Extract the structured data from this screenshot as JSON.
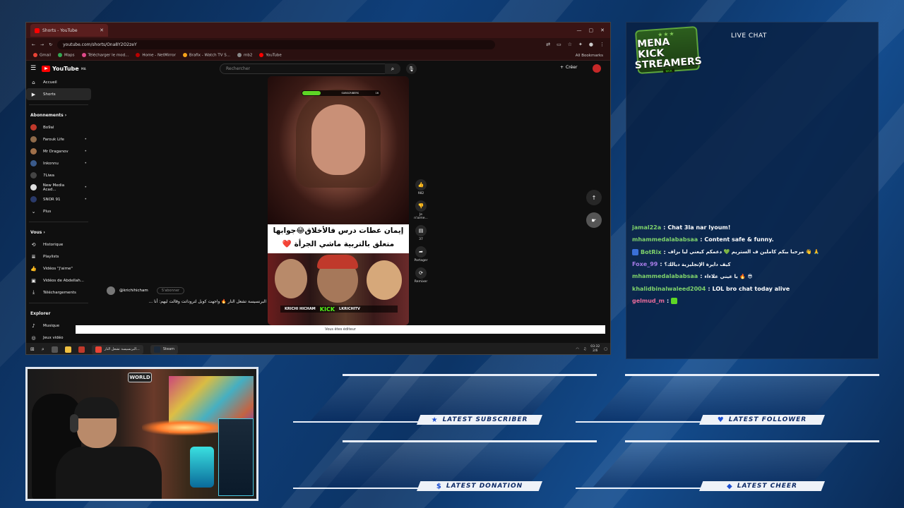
{
  "browser": {
    "tab_title": "Shorts - YouTube",
    "url": "youtube.com/shorts/Ona8Y2O2zeY",
    "bookmarks": [
      "Gmail",
      "Maps",
      "Télécharger le mod...",
      "Home - NetMirror",
      "Brafix - Watch TV S...",
      "mb2",
      "YouTube"
    ],
    "all_bookmarks": "All Bookmarks"
  },
  "youtube": {
    "logo": "YouTube",
    "region": "MA",
    "search_placeholder": "Rechercher",
    "create_label": "Créer",
    "sidebar": {
      "main": [
        {
          "label": "Accueil",
          "icon": "home-icon"
        },
        {
          "label": "Shorts",
          "icon": "shorts-icon",
          "active": true
        }
      ],
      "subscriptions_header": "Abonnements",
      "subscriptions": [
        {
          "label": "Bo9al",
          "dot": false
        },
        {
          "label": "Farouk Life",
          "dot": true
        },
        {
          "label": "Mr Draganov",
          "dot": true
        },
        {
          "label": "Inkonnu",
          "dot": true
        },
        {
          "label": "7Liwa",
          "dot": false
        },
        {
          "label": "New Media Acad...",
          "dot": true
        },
        {
          "label": "SNOR 91",
          "dot": true
        },
        {
          "label": "Plus",
          "dot": false
        }
      ],
      "you_header": "Vous",
      "you": [
        {
          "label": "Historique",
          "icon": "history-icon"
        },
        {
          "label": "Playlists",
          "icon": "playlist-icon"
        },
        {
          "label": "Vidéos \"J'aime\"",
          "icon": "like-icon"
        },
        {
          "label": "Vidéos de Abdellah...",
          "icon": "video-icon"
        },
        {
          "label": "Téléchargements",
          "icon": "download-icon"
        }
      ],
      "explore_header": "Explorer",
      "explore": [
        {
          "label": "Musique",
          "icon": "music-icon"
        },
        {
          "label": "Jeux vidéo",
          "icon": "game-icon"
        }
      ]
    },
    "short": {
      "sub_bar_label": "SUBSCRIBERS",
      "sub_bar_count": "16",
      "caption_line1": "إيمان عطات درس فالأخلاق😂جوابها",
      "caption_line2": "متعلق بالتربية ماشي الجرأة ❤️",
      "banner_name": "KRICHI HICHAM",
      "banner_kick": "KICK",
      "banner_handle": "LKRICHITV",
      "channel": "@krichihicham",
      "subscribe": "S'abonner",
      "title": "البرنسيسة تشعل النار 🔥 واجهت كوبل لتروداتت وقالت ليهم: أنا ..."
    },
    "actions": [
      {
        "icon": "thumbs-up-icon",
        "label": "982"
      },
      {
        "icon": "thumbs-down-icon",
        "label": "Je n'aime..."
      },
      {
        "icon": "comment-icon",
        "label": "37"
      },
      {
        "icon": "share-icon",
        "label": "Partager"
      },
      {
        "icon": "remix-icon",
        "label": "Remixer"
      }
    ],
    "editor_notice": "Vous êtes éditeur"
  },
  "taskbar": {
    "app1": "البرنسيسة تشعل النار...",
    "app2": "Steam",
    "time": "03:32",
    "date": "2/6"
  },
  "chat": {
    "title": "LIVE CHAT",
    "logo_line1": "MENA KICK",
    "logo_line2": "STREAMERS",
    "logo_sub": "KICK",
    "messages": [
      {
        "user": "jamal22a",
        "color": "#7fd36b",
        "text": "Chat 3la nar lyoum!",
        "badge": false,
        "emote": false
      },
      {
        "user": "mhammedalababsaa",
        "color": "#7fd36b",
        "text": "Content safe & funny.",
        "badge": false,
        "emote": false
      },
      {
        "user": "BotRix",
        "color": "#7fd36b",
        "text": "مرحبا بيكم كاملين ف الستريم 💚 دعمكم كيعني ليا بزاف 👋 🙏",
        "badge": true,
        "emote": false
      },
      {
        "user": "Foxe_99",
        "color": "#a77ce8",
        "text": "كيف دايرة الإنجليزية ديالك؟",
        "badge": false,
        "emote": false
      },
      {
        "user": "mhammedalababsaa",
        "color": "#7fd36b",
        "text": "يا عيني علاءاء 🔥 😎",
        "badge": false,
        "emote": false
      },
      {
        "user": "khalidbinalwaleed2004",
        "color": "#7fd36b",
        "text": "LOL bro chat today alive",
        "badge": false,
        "emote": false
      },
      {
        "user": "gelmud_m",
        "color": "#e86b9a",
        "text": "",
        "badge": false,
        "emote": true
      }
    ]
  },
  "cam": {
    "sign": "WORLD"
  },
  "alerts": {
    "subscriber": "LATEST SUBSCRIBER",
    "follower": "LATEST FOLLOWER",
    "donation": "LATEST DONATION",
    "cheer": "LATEST CHEER"
  }
}
